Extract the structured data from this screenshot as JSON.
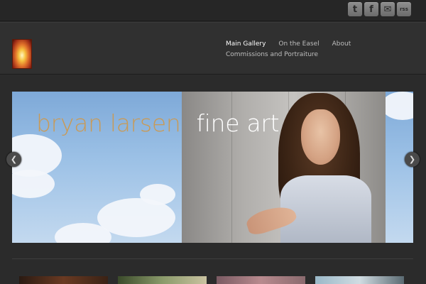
{
  "social": {
    "twitter_icon": "t",
    "facebook_icon": "f",
    "email_icon": "✉",
    "rss_icon": "rss"
  },
  "nav": {
    "items": [
      {
        "label": "Main Gallery",
        "active": true
      },
      {
        "label": "On the Easel",
        "active": false
      },
      {
        "label": "About",
        "active": false
      },
      {
        "label": "Commissions and Portraiture",
        "active": false
      }
    ]
  },
  "slider": {
    "title_part1": "bryan larsen",
    "title_part2": "fine art",
    "prev_icon": "❮",
    "next_icon": "❯"
  },
  "colors": {
    "background": "#2b2b2b",
    "title_accent": "#c99a56",
    "nav_active": "#ffffff",
    "nav_inactive": "#bdbdbd"
  }
}
